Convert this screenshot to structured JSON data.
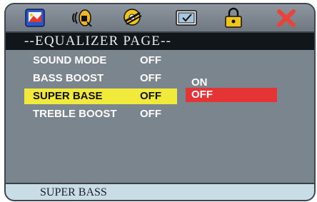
{
  "toolbar": {
    "icons": [
      "general-setup-icon",
      "audio-setup-icon",
      "video-setup-icon",
      "preferences-icon",
      "password-lock-icon",
      "exit-icon"
    ]
  },
  "page_title": "--EQUALIZER PAGE--",
  "menu": {
    "items": [
      {
        "label": "SOUND MODE",
        "value": "OFF"
      },
      {
        "label": "BASS BOOST",
        "value": "OFF"
      },
      {
        "label": "SUPER BASE",
        "value": "OFF"
      },
      {
        "label": "TREBLE BOOST",
        "value": "OFF"
      }
    ],
    "selected_index": 2
  },
  "submenu": {
    "options": [
      "ON",
      "OFF"
    ],
    "highlighted": "OFF"
  },
  "status_bar": "SUPER BASS",
  "colors": {
    "panel": "#7b858e",
    "title_bar": "#11161b",
    "selection": "#f2ea3a",
    "option_highlight": "#e53436",
    "status_bar": "#c9dde7"
  }
}
